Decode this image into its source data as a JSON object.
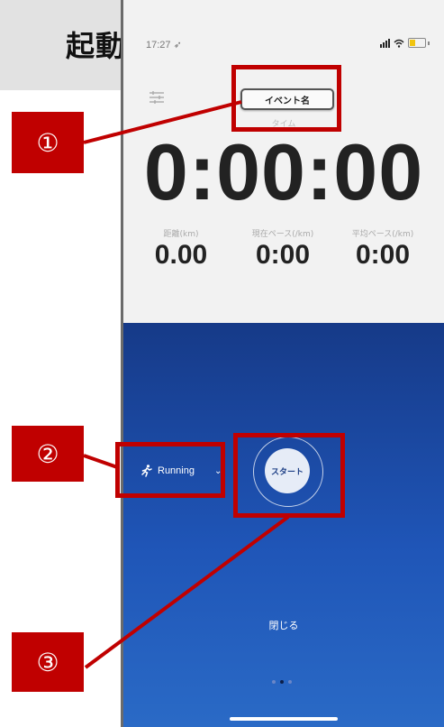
{
  "header": {
    "title": "起動"
  },
  "status_bar": {
    "time": "17:27 ➶"
  },
  "timer": {
    "event_name_label": "イベント名",
    "time_label": "タイム",
    "time_value": "0:00:00"
  },
  "metrics": [
    {
      "label": "距離(km)",
      "value": "0.00"
    },
    {
      "label": "現在ペース(/km)",
      "value": "0:00"
    },
    {
      "label": "平均ペース(/km)",
      "value": "0:00"
    }
  ],
  "controls": {
    "activity_label": "Running",
    "start_label": "スタート",
    "close_label": "閉じる"
  },
  "page_indicator": {
    "count": 3,
    "active": 1
  },
  "callouts": [
    "①",
    "②",
    "③"
  ],
  "colors": {
    "annotation": "#c00000",
    "panel": "#1f55b7"
  }
}
